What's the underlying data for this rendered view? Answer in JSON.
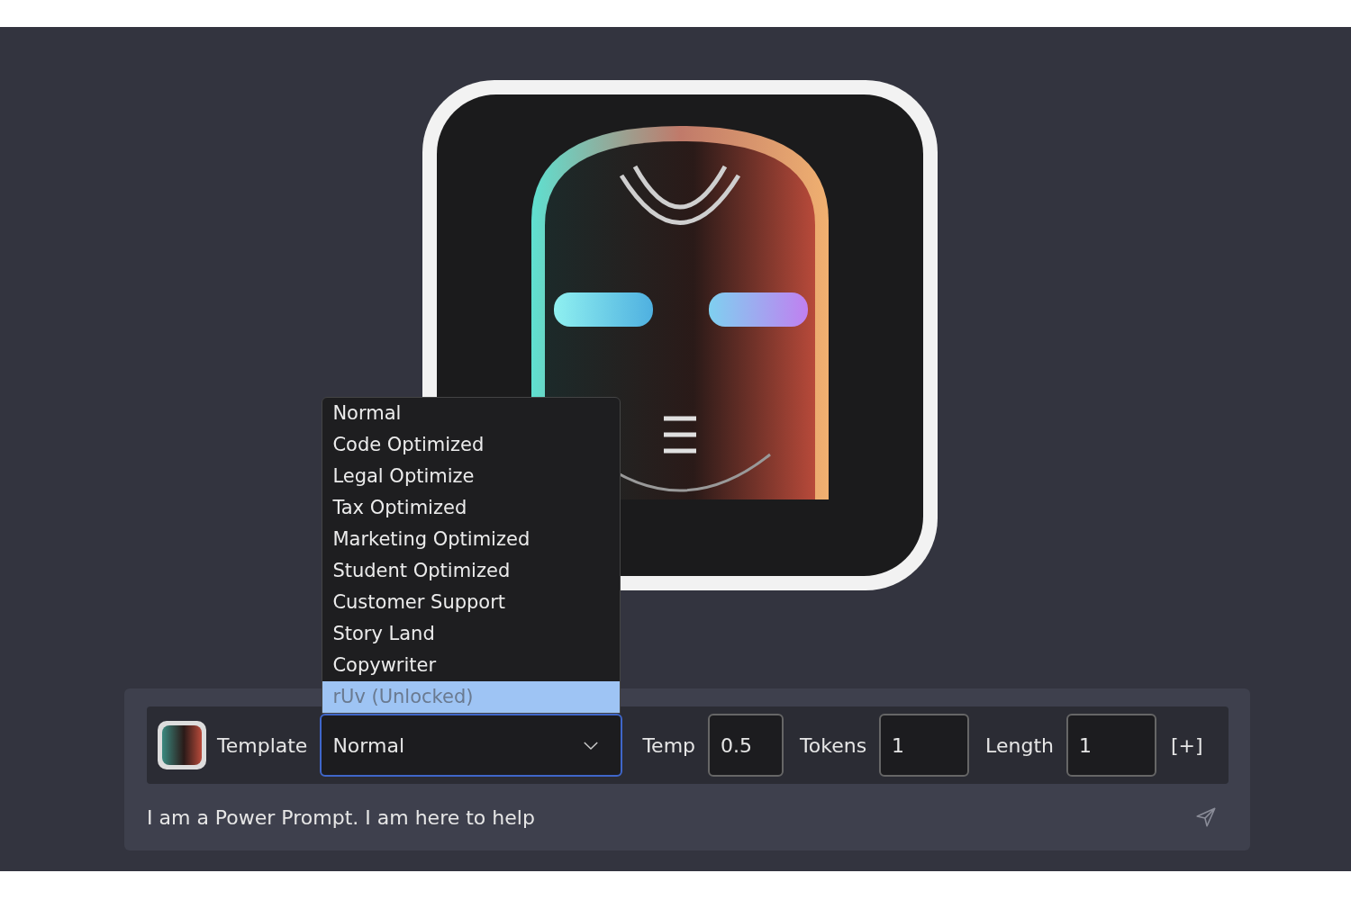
{
  "template_picker": {
    "label": "Template",
    "value": "Normal",
    "expanded": true,
    "options": [
      {
        "label": "Normal",
        "highlighted": false
      },
      {
        "label": "Code Optimized",
        "highlighted": false
      },
      {
        "label": "Legal Optimize",
        "highlighted": false
      },
      {
        "label": "Tax Optimized",
        "highlighted": false
      },
      {
        "label": "Marketing Optimized",
        "highlighted": false
      },
      {
        "label": "Student Optimized",
        "highlighted": false
      },
      {
        "label": "Customer Support",
        "highlighted": false
      },
      {
        "label": "Story Land",
        "highlighted": false
      },
      {
        "label": "Copywriter",
        "highlighted": false
      },
      {
        "label": "rUv (Unlocked)",
        "highlighted": true
      }
    ]
  },
  "settings": [
    {
      "label": "Temp",
      "value": "0.5"
    },
    {
      "label": "Tokens",
      "value": "1"
    },
    {
      "label": "Length",
      "value": "1"
    }
  ],
  "add_button": "[+]",
  "prompt": {
    "placeholder": "I am a Power Prompt. I am here to help"
  }
}
